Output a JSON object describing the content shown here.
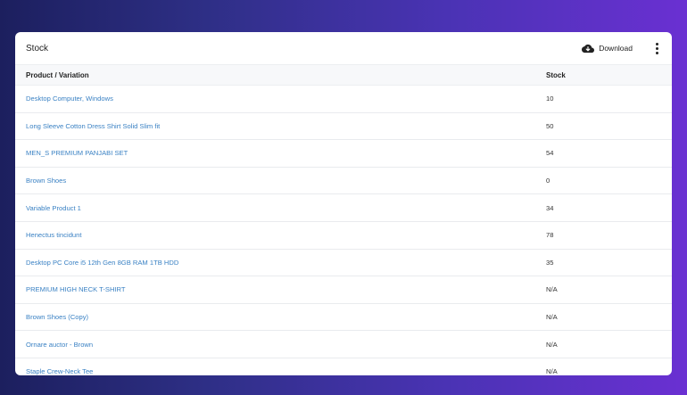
{
  "card": {
    "title": "Stock",
    "download_label": "Download",
    "download_icon": "cloud-download-icon",
    "more_icon": "kebab-menu-icon"
  },
  "table": {
    "headers": [
      "Product / Variation",
      "Stock"
    ],
    "rows": [
      {
        "product": "Desktop Computer, Windows",
        "stock": "10"
      },
      {
        "product": "Long Sleeve Cotton Dress Shirt Solid Slim fit",
        "stock": "50"
      },
      {
        "product": "MEN_S PREMIUM PANJABI SET",
        "stock": "54"
      },
      {
        "product": "Brown Shoes",
        "stock": "0"
      },
      {
        "product": "Variable Product 1",
        "stock": "34"
      },
      {
        "product": "Henectus tincidunt",
        "stock": "78"
      },
      {
        "product": "Desktop PC Core i5 12th Gen 8GB RAM 1TB HDD",
        "stock": "35"
      },
      {
        "product": "PREMIUM HIGH NECK T-SHIRT",
        "stock": "N/A"
      },
      {
        "product": "Brown Shoes (Copy)",
        "stock": "N/A"
      },
      {
        "product": "Ornare auctor - Brown",
        "stock": "N/A"
      },
      {
        "product": "Staple Crew-Neck Tee",
        "stock": "N/A"
      }
    ]
  },
  "colors": {
    "link": "#3b82c4",
    "header_bg": "#f7f8fa"
  }
}
